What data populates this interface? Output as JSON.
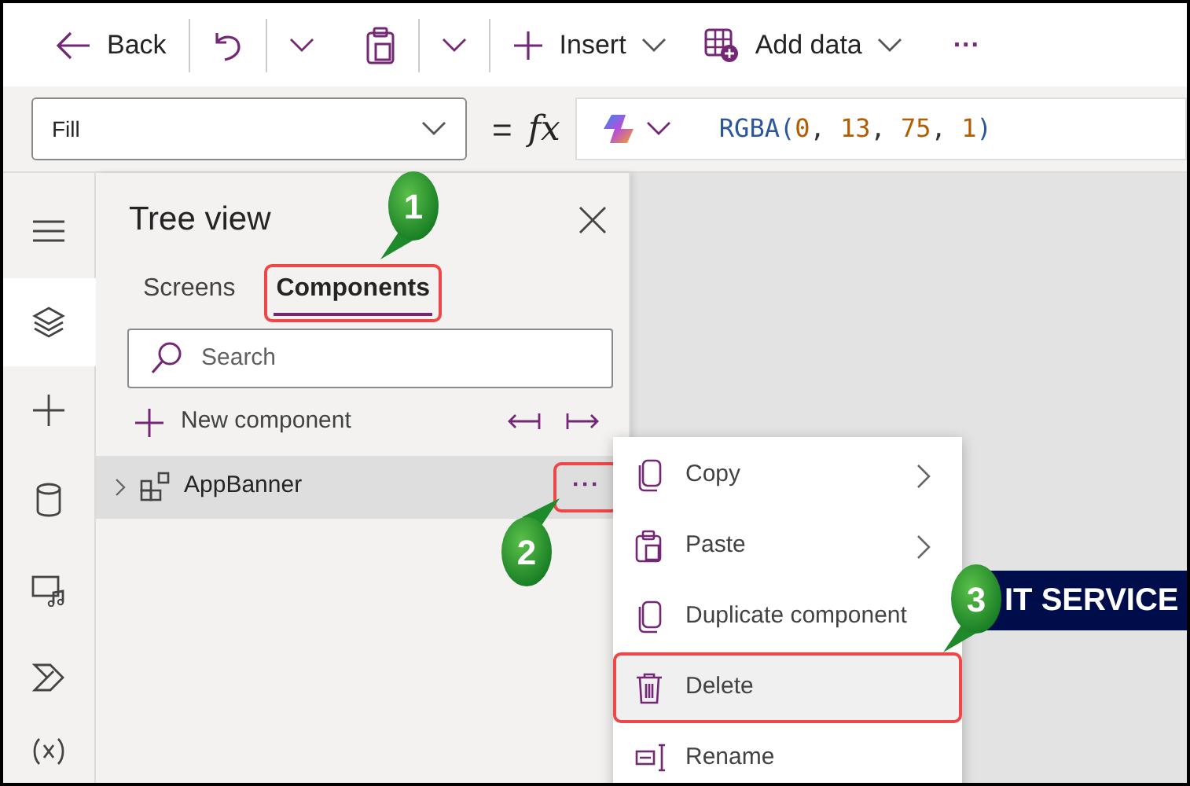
{
  "toolbar": {
    "back": "Back",
    "insert": "Insert",
    "add_data": "Add data",
    "more": "···"
  },
  "formula_bar": {
    "property": "Fill",
    "equals": "=",
    "fx": "fx",
    "formula": [
      {
        "text": "RGBA(",
        "kind": "function"
      },
      {
        "text": "0",
        "kind": "number"
      },
      {
        "text": ", ",
        "kind": "plain"
      },
      {
        "text": "13",
        "kind": "number"
      },
      {
        "text": ", ",
        "kind": "plain"
      },
      {
        "text": "75",
        "kind": "number"
      },
      {
        "text": ", ",
        "kind": "plain"
      },
      {
        "text": "1",
        "kind": "number"
      },
      {
        "text": ")",
        "kind": "function"
      }
    ]
  },
  "rail": [
    {
      "kind": "menu",
      "selected": false
    },
    {
      "kind": "layers",
      "selected": true
    },
    {
      "kind": "insert",
      "selected": false
    },
    {
      "kind": "data",
      "selected": false
    },
    {
      "kind": "media",
      "selected": false
    },
    {
      "kind": "automate",
      "selected": false
    },
    {
      "kind": "variables",
      "selected": false
    }
  ],
  "tree_view": {
    "title": "Tree view",
    "tabs": [
      {
        "label": "Screens",
        "selected": false,
        "highlighted": false
      },
      {
        "label": "Components",
        "selected": true,
        "highlighted": true
      }
    ],
    "search": {
      "placeholder": "Search"
    },
    "new_component": "New component",
    "items": [
      {
        "label": "AppBanner",
        "expanded": false,
        "selected": true,
        "more": "···",
        "more_highlighted": true
      }
    ]
  },
  "context_menu": [
    {
      "label": "Copy",
      "kind": "copy",
      "submenu": true,
      "hovered": false,
      "highlighted": false
    },
    {
      "label": "Paste",
      "kind": "paste",
      "submenu": true,
      "hovered": false,
      "highlighted": false
    },
    {
      "label": "Duplicate component",
      "kind": "copy",
      "submenu": false,
      "hovered": false,
      "highlighted": false
    },
    {
      "label": "Delete",
      "kind": "delete",
      "submenu": false,
      "hovered": true,
      "highlighted": true
    },
    {
      "label": "Rename",
      "kind": "rename",
      "submenu": false,
      "hovered": false,
      "highlighted": false
    }
  ],
  "canvas": {
    "banner": "IT SERVICE"
  },
  "callouts": [
    {
      "label": "1"
    },
    {
      "label": "2"
    },
    {
      "label": "3"
    }
  ]
}
